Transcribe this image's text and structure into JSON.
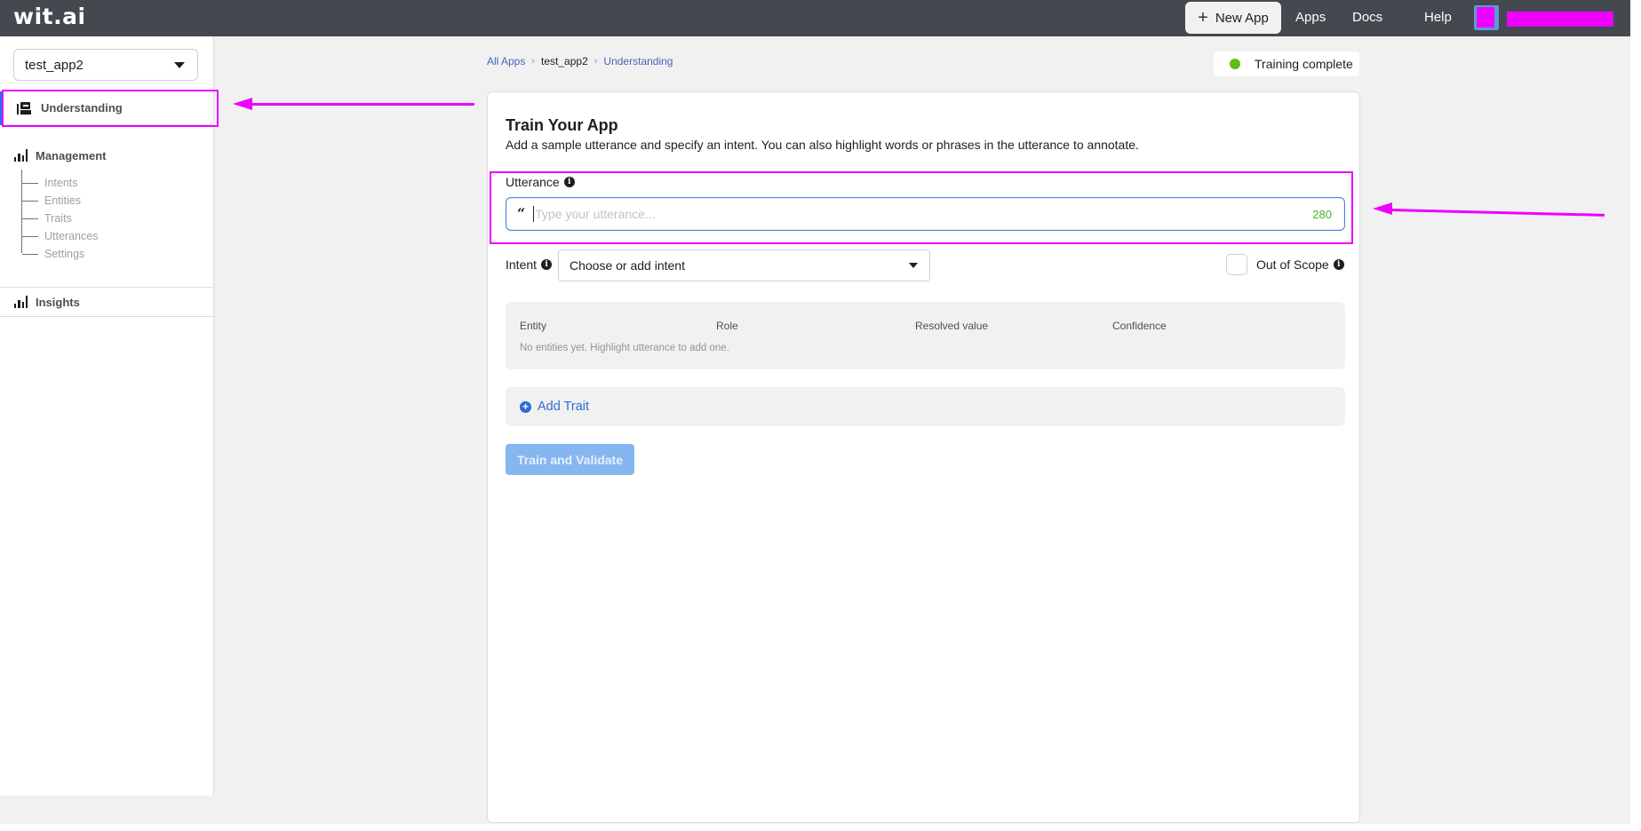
{
  "header": {
    "logo": "wit.ai",
    "new_app_label": "New App",
    "nav": [
      "Apps",
      "Docs",
      "Help"
    ],
    "username_redacted": true
  },
  "sidebar": {
    "app_selector_value": "test_app2",
    "items": [
      {
        "label": "Understanding",
        "icon": "robot-icon",
        "active": true
      },
      {
        "label": "Management",
        "icon": "bar-chart-icon",
        "active": false
      },
      {
        "label": "Insights",
        "icon": "bar-chart-icon",
        "active": false
      }
    ],
    "management_children": [
      "Intents",
      "Entities",
      "Traits",
      "Utterances",
      "Settings"
    ]
  },
  "breadcrumb": [
    "All Apps",
    "test_app2",
    "Understanding"
  ],
  "status": {
    "label": "Training complete",
    "color": "#62bc18"
  },
  "card": {
    "title": "Train Your App",
    "description": "Add a sample utterance and specify an intent. You can also highlight words or phrases in the utterance to annotate.",
    "utterance": {
      "label": "Utterance",
      "value": "",
      "placeholder": "Type your utterance...",
      "char_count": "280"
    },
    "intent": {
      "label": "Intent",
      "selected": "Choose or add intent"
    },
    "out_of_scope": {
      "label": "Out of Scope",
      "checked": false
    },
    "entity_table": {
      "columns": [
        "Entity",
        "Role",
        "Resolved value",
        "Confidence"
      ],
      "empty_message": "No entities yet. Highlight utterance to add one."
    },
    "add_trait_label": "Add Trait",
    "train_button_label": "Train and Validate"
  },
  "colors": {
    "header_bg": "#444950",
    "accent": "#1877f2",
    "link": "#4267b2",
    "annotation": "#ee00ff",
    "train_button_disabled": "#86b6f0"
  }
}
